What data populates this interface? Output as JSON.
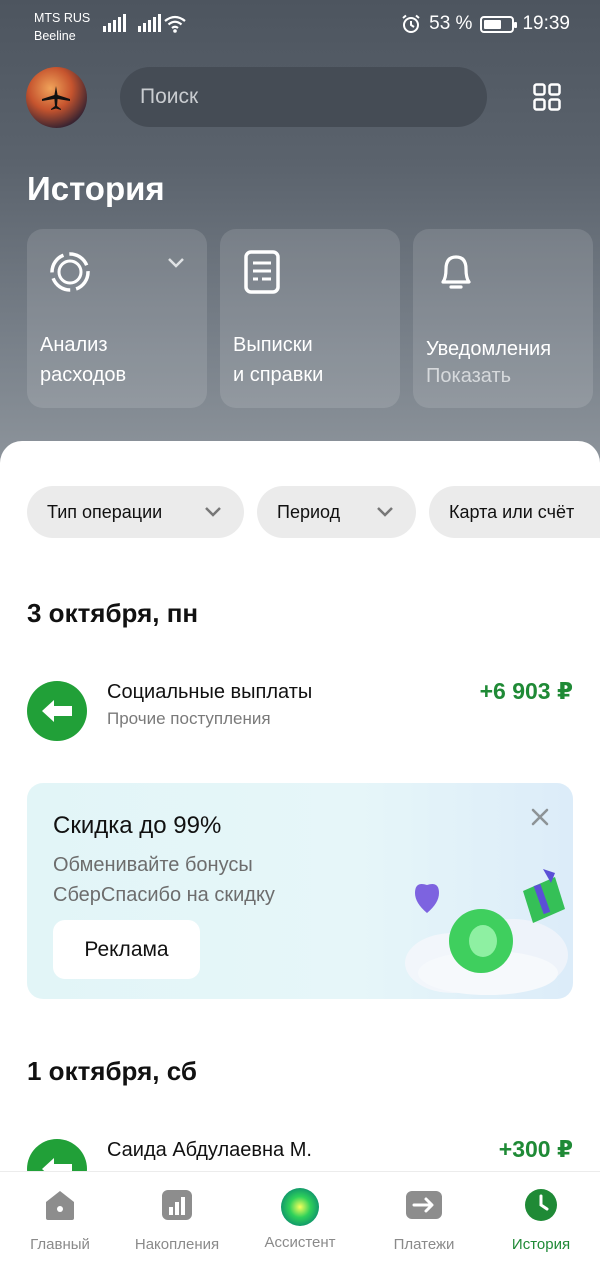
{
  "status_bar": {
    "carrier_1": "MTS RUS",
    "carrier_2": "Beeline",
    "battery": "53 %",
    "time": "19:39"
  },
  "header": {
    "search_placeholder": "Поиск",
    "title": "История"
  },
  "tiles": [
    {
      "line1": "Анализ",
      "line2": "расходов",
      "icon": "expenses-ring-icon"
    },
    {
      "line1": "Выписки",
      "line2": "и справки",
      "icon": "document-icon"
    },
    {
      "line1": "Уведомления",
      "line2": "Показать",
      "icon": "bell-icon"
    }
  ],
  "filters": [
    {
      "label": "Тип операции"
    },
    {
      "label": "Период"
    },
    {
      "label": "Карта или счёт"
    }
  ],
  "groups": [
    {
      "date": "3 октября, пн",
      "operations": [
        {
          "name": "Социальные выплаты",
          "category": "Прочие поступления",
          "amount": "+6 903 ₽"
        }
      ]
    },
    {
      "date": "1 октября, сб",
      "operations": [
        {
          "name": "Саида Абдулаевна М.",
          "category": "",
          "amount": "+300 ₽"
        }
      ]
    }
  ],
  "ad": {
    "title": "Скидка до 99%",
    "line1": "Обменивайте бонусы",
    "line2": "СберСпасибо на скидку",
    "button": "Реклама"
  },
  "nav": [
    {
      "label": "Главный",
      "icon": "home-icon"
    },
    {
      "label": "Накопления",
      "icon": "savings-chart-icon"
    },
    {
      "label": "Ассистент",
      "icon": "assistant-orb-icon"
    },
    {
      "label": "Платежи",
      "icon": "payments-arrow-icon"
    },
    {
      "label": "История",
      "icon": "history-clock-icon",
      "active": true
    }
  ],
  "colors": {
    "accent_green": "#21a038",
    "amount_green": "#1f8a36"
  }
}
